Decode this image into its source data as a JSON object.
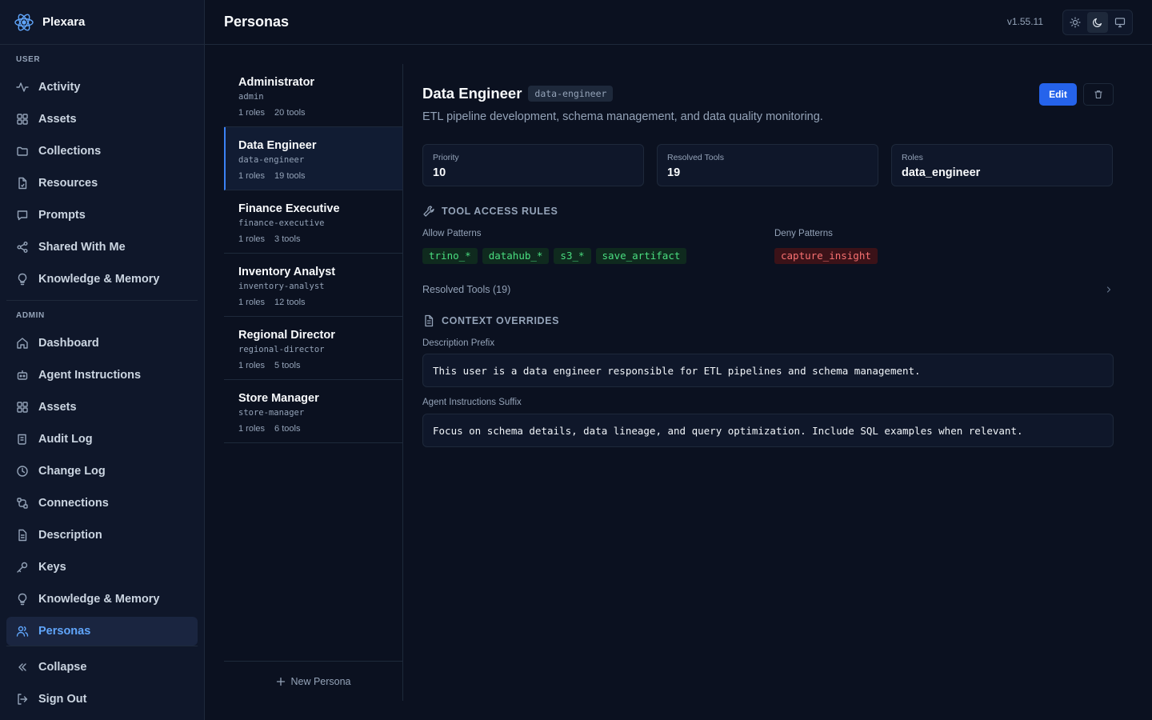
{
  "app": {
    "name": "Plexara",
    "version": "v1.55.11"
  },
  "sidebar": {
    "user_label": "USER",
    "admin_label": "ADMIN",
    "user_items": [
      {
        "label": "Activity",
        "icon": "activity-icon"
      },
      {
        "label": "Assets",
        "icon": "grid-icon"
      },
      {
        "label": "Collections",
        "icon": "folder-icon"
      },
      {
        "label": "Resources",
        "icon": "file-icon"
      },
      {
        "label": "Prompts",
        "icon": "message-icon"
      },
      {
        "label": "Shared With Me",
        "icon": "share-icon"
      },
      {
        "label": "Knowledge & Memory",
        "icon": "lightbulb-icon"
      }
    ],
    "admin_items": [
      {
        "label": "Dashboard",
        "icon": "home-icon"
      },
      {
        "label": "Agent Instructions",
        "icon": "bot-icon"
      },
      {
        "label": "Assets",
        "icon": "grid-icon"
      },
      {
        "label": "Audit Log",
        "icon": "scroll-icon"
      },
      {
        "label": "Change Log",
        "icon": "clock-icon"
      },
      {
        "label": "Connections",
        "icon": "connections-icon"
      },
      {
        "label": "Description",
        "icon": "file-text-icon"
      },
      {
        "label": "Keys",
        "icon": "key-icon"
      },
      {
        "label": "Knowledge & Memory",
        "icon": "lightbulb-icon"
      },
      {
        "label": "Personas",
        "icon": "users-icon",
        "active": true
      }
    ],
    "collapse_label": "Collapse",
    "signout_label": "Sign Out"
  },
  "header": {
    "title": "Personas"
  },
  "personas": [
    {
      "name": "Administrator",
      "slug": "admin",
      "roles": "1 roles",
      "tools": "20 tools"
    },
    {
      "name": "Data Engineer",
      "slug": "data-engineer",
      "roles": "1 roles",
      "tools": "19 tools",
      "active": true
    },
    {
      "name": "Finance Executive",
      "slug": "finance-executive",
      "roles": "1 roles",
      "tools": "3 tools"
    },
    {
      "name": "Inventory Analyst",
      "slug": "inventory-analyst",
      "roles": "1 roles",
      "tools": "12 tools"
    },
    {
      "name": "Regional Director",
      "slug": "regional-director",
      "roles": "1 roles",
      "tools": "5 tools"
    },
    {
      "name": "Store Manager",
      "slug": "store-manager",
      "roles": "1 roles",
      "tools": "6 tools"
    }
  ],
  "new_persona_label": "New Persona",
  "detail": {
    "title": "Data Engineer",
    "slug": "data-engineer",
    "description": "ETL pipeline development, schema management, and data quality monitoring.",
    "edit_label": "Edit",
    "stats": [
      {
        "label": "Priority",
        "value": "10"
      },
      {
        "label": "Resolved Tools",
        "value": "19"
      },
      {
        "label": "Roles",
        "value": "data_engineer"
      }
    ],
    "tool_access_heading": "TOOL ACCESS RULES",
    "allow_label": "Allow Patterns",
    "allow_patterns": [
      "trino_*",
      "datahub_*",
      "s3_*",
      "save_artifact"
    ],
    "deny_label": "Deny Patterns",
    "deny_patterns": [
      "capture_insight"
    ],
    "resolved_tools_label": "Resolved Tools (19)",
    "context_heading": "CONTEXT OVERRIDES",
    "description_prefix_label": "Description Prefix",
    "description_prefix": "This user is a data engineer responsible for ETL pipelines and schema management.",
    "agent_suffix_label": "Agent Instructions Suffix",
    "agent_suffix": "Focus on schema details, data lineage, and query optimization. Include SQL examples when relevant."
  },
  "colors": {
    "accent": "#2563eb",
    "active_text": "#60a5fa",
    "allow": "#4ade80",
    "deny": "#f87171",
    "background": "#0b1120"
  }
}
